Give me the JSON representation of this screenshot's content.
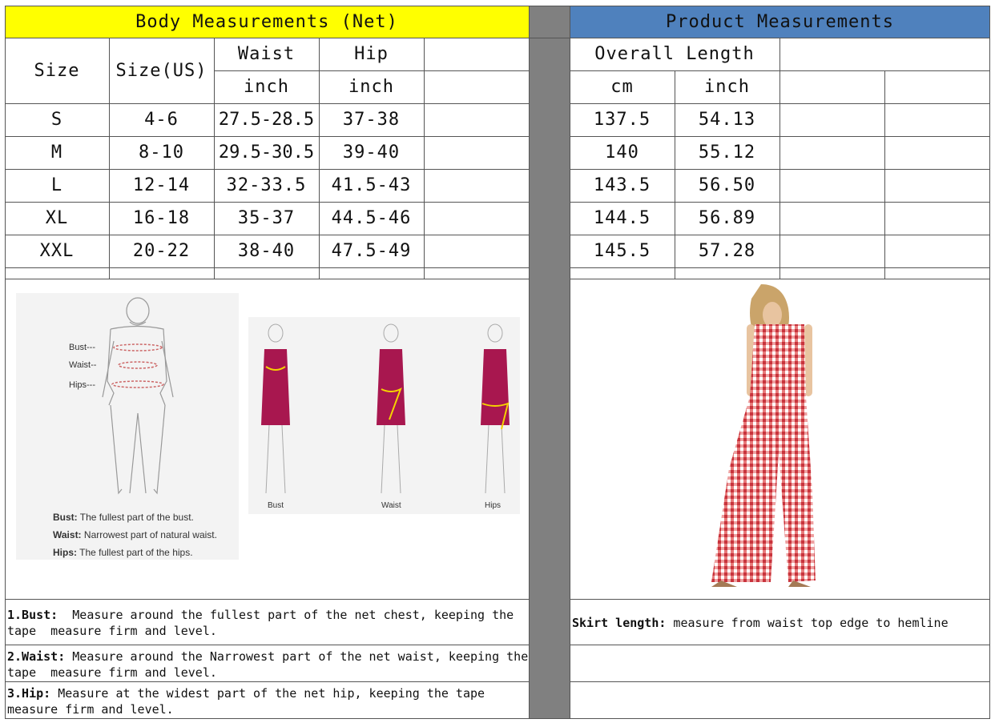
{
  "body_header": "Body Measurements (Net)",
  "product_header": "Product Measurements",
  "colors": {
    "body_header_bg": "#ffff00",
    "product_header_bg": "#4f81bd",
    "divider": "#808080"
  },
  "columns": {
    "size": "Size",
    "size_us": "Size(US)",
    "waist": "Waist",
    "hip": "Hip",
    "waist_unit": "inch",
    "hip_unit": "inch",
    "overall_length": "Overall Length",
    "length_cm": "cm",
    "length_inch": "inch"
  },
  "rows": [
    {
      "size": "S",
      "us": "4-6",
      "waist": "27.5-28.5",
      "hip": "37-38",
      "cm": "137.5",
      "inch": "54.13"
    },
    {
      "size": "M",
      "us": "8-10",
      "waist": "29.5-30.5",
      "hip": "39-40",
      "cm": "140",
      "inch": "55.12"
    },
    {
      "size": "L",
      "us": "12-14",
      "waist": "32-33.5",
      "hip": "41.5-43",
      "cm": "143.5",
      "inch": "56.50"
    },
    {
      "size": "XL",
      "us": "16-18",
      "waist": "35-37",
      "hip": "44.5-46",
      "cm": "144.5",
      "inch": "56.89"
    },
    {
      "size": "XXL",
      "us": "20-22",
      "waist": "38-40",
      "hip": "47.5-49",
      "cm": "145.5",
      "inch": "57.28"
    }
  ],
  "diagram": {
    "labels": [
      "Bust---",
      "Waist--",
      "Hips---"
    ],
    "legend": [
      {
        "term": "Bust:",
        "desc": "The fullest part of the bust."
      },
      {
        "term": "Waist:",
        "desc": "Narrowest part of natural waist."
      },
      {
        "term": "Hips:",
        "desc": "The fullest part of the hips."
      }
    ],
    "figure_labels": [
      "Bust",
      "Waist",
      "Hips"
    ]
  },
  "notes": [
    {
      "term": "1.Bust:",
      "text": "  Measure around the fullest part of the net chest, keeping the tape  measure firm and level."
    },
    {
      "term": "2.Waist:",
      "text": " Measure around the Narrowest part of the net waist, keeping the tape  measure firm and level."
    },
    {
      "term": "3.Hip:",
      "text": " Measure at the widest part of the net hip, keeping the tape measure firm and level."
    }
  ],
  "product_note": {
    "term": "Skirt length:",
    "text": " measure from waist top edge to hemline"
  }
}
